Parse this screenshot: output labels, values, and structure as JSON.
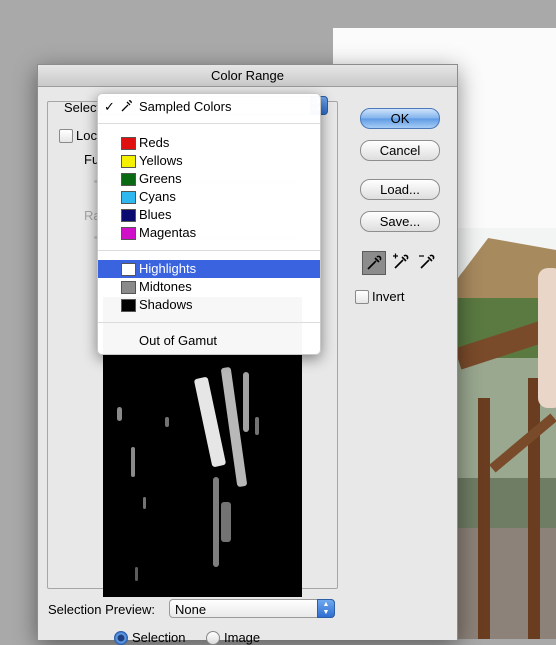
{
  "dialog": {
    "title": "Color Range",
    "select_label": "Select",
    "localized_label": "Localized Color Clusters",
    "localized_short": "Loc",
    "fuzziness_label": "Fuzziness:",
    "fuzziness_short": "Fu",
    "range_label": "Range:",
    "range_short": "Ra",
    "view_options": [
      {
        "label": "Selection",
        "selected": true
      },
      {
        "label": "Image",
        "selected": false
      }
    ],
    "buttons": {
      "ok": "OK",
      "cancel": "Cancel",
      "load": "Load...",
      "save": "Save..."
    },
    "tools": [
      "eyedropper-icon",
      "eyedropper-plus-icon",
      "eyedropper-minus-icon"
    ],
    "invert_label": "Invert",
    "selection_preview_label": "Selection Preview:",
    "selection_preview_value": "None"
  },
  "menu": {
    "items": [
      {
        "label": "Sampled Colors",
        "checked": true,
        "icon": "eyedropper-icon"
      },
      {
        "label": "Reds",
        "swatch": "#e01010"
      },
      {
        "label": "Yellows",
        "swatch": "#f5f000"
      },
      {
        "label": "Greens",
        "swatch": "#0a6a14"
      },
      {
        "label": "Cyans",
        "swatch": "#2fb7f0"
      },
      {
        "label": "Blues",
        "swatch": "#0a0a70"
      },
      {
        "label": "Magentas",
        "swatch": "#d010c8"
      },
      {
        "label": "Highlights",
        "swatch": "#ffffff",
        "highlighted": true
      },
      {
        "label": "Midtones",
        "swatch": "#8a8a8a"
      },
      {
        "label": "Shadows",
        "swatch": "#000000"
      },
      {
        "label": "Out of Gamut"
      }
    ]
  },
  "colors": {
    "accent": "#3a63df",
    "default_button": "#5e9ae4"
  }
}
